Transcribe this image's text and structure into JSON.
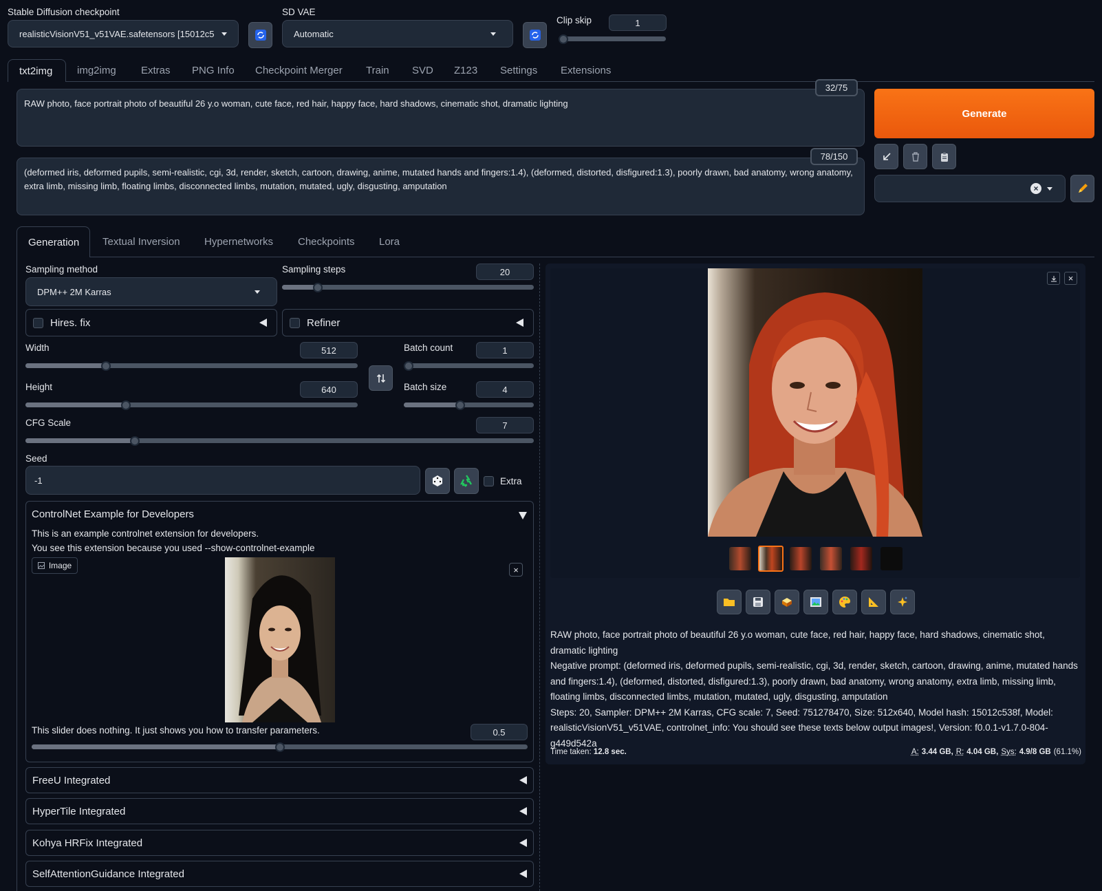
{
  "top": {
    "checkpoint_label": "Stable Diffusion checkpoint",
    "checkpoint_value": "realisticVisionV51_v51VAE.safetensors [15012c5",
    "vae_label": "SD VAE",
    "vae_value": "Automatic",
    "clip_skip_label": "Clip skip",
    "clip_skip_value": "1",
    "clip_skip_fraction": 0.0
  },
  "tabs": [
    "txt2img",
    "img2img",
    "Extras",
    "PNG Info",
    "Checkpoint Merger",
    "Train",
    "SVD",
    "Z123",
    "Settings",
    "Extensions"
  ],
  "prompt": {
    "text": "RAW photo, face portrait photo of beautiful 26 y.o woman, cute face, red hair, happy face, hard shadows, cinematic shot, dramatic lighting",
    "token_count": "32/75"
  },
  "negative_prompt": {
    "text": "(deformed iris, deformed pupils, semi-realistic, cgi, 3d, render, sketch, cartoon, drawing, anime, mutated hands and fingers:1.4), (deformed, distorted, disfigured:1.3), poorly drawn, bad anatomy, wrong anatomy, extra limb, missing limb, floating limbs, disconnected limbs, mutation, mutated, ugly, disgusting, amputation",
    "token_count": "78/150"
  },
  "generate_label": "Generate",
  "colors": {
    "accent": "#f2711c",
    "bg": "#0b0f19",
    "panel": "#1f2937"
  },
  "subtabs": [
    "Generation",
    "Textual Inversion",
    "Hypernetworks",
    "Checkpoints",
    "Lora"
  ],
  "sampling": {
    "method_label": "Sampling method",
    "method_value": "DPM++ 2M Karras",
    "steps_label": "Sampling steps",
    "steps_value": "20"
  },
  "hires_label": "Hires. fix",
  "refiner_label": "Refiner",
  "width": {
    "label": "Width",
    "value": "512"
  },
  "height": {
    "label": "Height",
    "value": "640"
  },
  "batch_count": {
    "label": "Batch count",
    "value": "1"
  },
  "batch_size": {
    "label": "Batch size",
    "value": "4"
  },
  "cfg": {
    "label": "CFG Scale",
    "value": "7"
  },
  "seed": {
    "label": "Seed",
    "value": "-1",
    "extra_label": "Extra"
  },
  "controlnet": {
    "title": "ControlNet Example for Developers",
    "line1": "This is an example controlnet extension for developers.",
    "line2": "You see this extension because you used --show-controlnet-example",
    "image_label": "Image",
    "slider_text": "This slider does nothing. It just shows you how to transfer parameters.",
    "slider_value": "0.5"
  },
  "accordions": [
    "FreeU Integrated",
    "HyperTile Integrated",
    "Kohya HRFix Integrated",
    "SelfAttentionGuidance Integrated"
  ],
  "output": {
    "prompt": "RAW photo, face portrait photo of beautiful 26 y.o woman, cute face, red hair, happy face, hard shadows, cinematic shot, dramatic lighting",
    "negative": "Negative prompt: (deformed iris, deformed pupils, semi-realistic, cgi, 3d, render, sketch, cartoon, drawing, anime, mutated hands and fingers:1.4), (deformed, distorted, disfigured:1.3), poorly drawn, bad anatomy, wrong anatomy, extra limb, missing limb, floating limbs, disconnected limbs, mutation, mutated, ugly, disgusting, amputation",
    "params": "Steps: 20, Sampler: DPM++ 2M Karras, CFG scale: 7, Seed: 751278470, Size: 512x640, Model hash: 15012c538f, Model: realisticVisionV51_v51VAE, controlnet_info: You should see these texts below output images!, Version: f0.0.1-v1.7.0-804-g449d542a",
    "time_label": "Time taken:",
    "time_value": "12.8 sec.",
    "mem_a_label": "A:",
    "mem_a": "3.44 GB,",
    "mem_r_label": "R:",
    "mem_r": "4.04 GB,",
    "mem_sys_label": "Sys:",
    "mem_sys": "4.9/8 GB",
    "mem_pct": "(61.1%)"
  },
  "icons": {
    "refresh": "refresh-icon",
    "tools": [
      "folder-icon",
      "save-icon",
      "zip-icon",
      "image-icon",
      "palette-icon",
      "ruler-icon",
      "sparkle-icon"
    ]
  }
}
